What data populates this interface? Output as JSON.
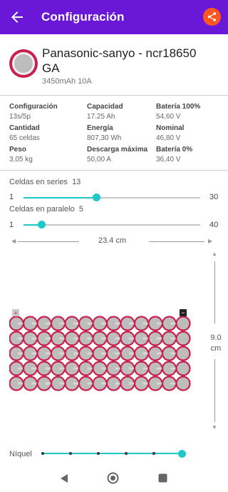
{
  "appbar": {
    "title": "Configuración",
    "back_icon": "arrow-left-icon",
    "share_icon": "share-icon"
  },
  "cell": {
    "name": "Panasonic-sanyo   - ncr18650 GA",
    "sub": "3450mAh  10A"
  },
  "specs": [
    {
      "key": "Configuración",
      "value": "13s/5p"
    },
    {
      "key": "Capacidad",
      "value": "17.25 Ah"
    },
    {
      "key": "Batería 100%",
      "value": "54,60 V"
    },
    {
      "key": "Cantidad",
      "value": "65 celdas"
    },
    {
      "key": "Energía",
      "value": "807,30 Wh"
    },
    {
      "key": "Nominal",
      "value": "46,80 V"
    },
    {
      "key": "Peso",
      "value": "3,05 kg"
    },
    {
      "key": "Descarga máxima",
      "value": "50,00 A"
    },
    {
      "key": "Batería 0%",
      "value": "36,40 V"
    }
  ],
  "series_slider": {
    "label": "Celdas en series",
    "value": "13",
    "min": "1",
    "max": "30"
  },
  "parallel_slider": {
    "label": "Celdas en paralelo",
    "value": "5",
    "min": "1",
    "max": "40"
  },
  "pack": {
    "width": "23.4 cm",
    "height_value": "9.0",
    "height_unit": "cm",
    "plus": "+",
    "minus": "−",
    "series": 13,
    "parallel": 5
  },
  "nickel": {
    "label": "Níquel",
    "level": 1.0
  },
  "colors": {
    "accent": "#6b17d8",
    "teal": "#1ec8c8",
    "cell_ring": "#c8204f",
    "cell_body": "#bdbdbd"
  }
}
